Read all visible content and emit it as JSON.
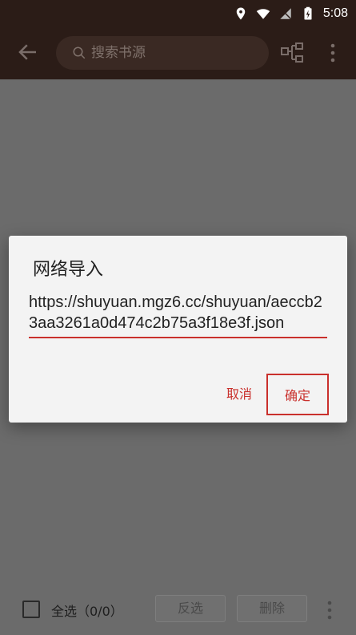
{
  "status_bar": {
    "time": "5:08"
  },
  "toolbar": {
    "search_placeholder": "搜索书源"
  },
  "dialog": {
    "title": "网络导入",
    "url_value": "https://shuyuan.mgz6.cc/shuyuan/aeccb23aa3261a0d474c2b75a3f18e3f.json",
    "cancel_label": "取消",
    "ok_label": "确定"
  },
  "bottom_bar": {
    "select_all_label": "全选（0/0）",
    "invert_label": "反选",
    "delete_label": "删除"
  },
  "colors": {
    "toolbar_bg": "#2b1c17",
    "accent": "#c9302c",
    "scrim": "#6b6b6b"
  }
}
